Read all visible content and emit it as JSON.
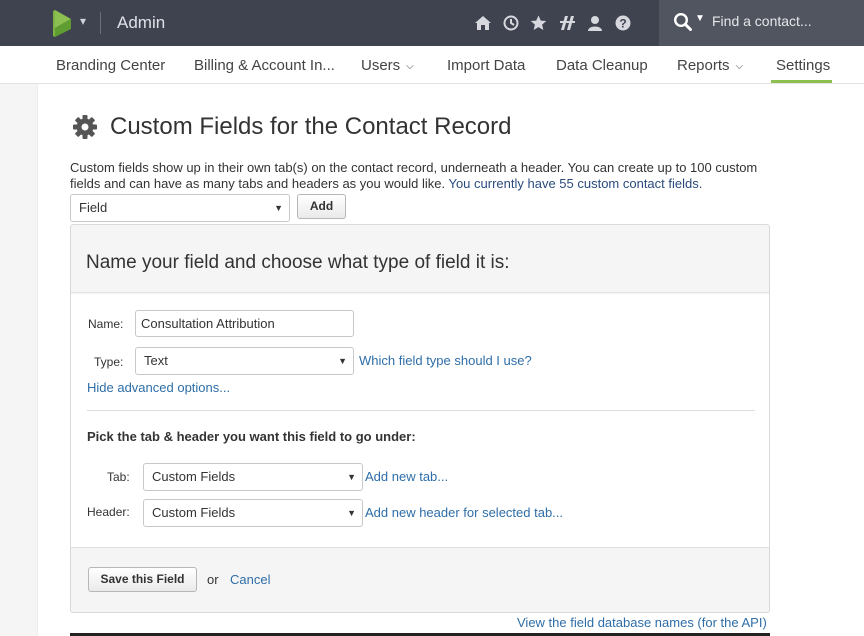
{
  "topbar": {
    "app_title": "Admin",
    "icons": [
      "home-icon",
      "history-icon",
      "star-icon",
      "dashboard-icon",
      "user-icon",
      "help-icon"
    ],
    "search_placeholder": "Find a contact..."
  },
  "nav": {
    "items": [
      {
        "label": "Branding Center",
        "has_dropdown": false
      },
      {
        "label": "Billing & Account In...",
        "has_dropdown": false
      },
      {
        "label": "Users",
        "has_dropdown": true
      },
      {
        "label": "Import Data",
        "has_dropdown": false
      },
      {
        "label": "Data Cleanup",
        "has_dropdown": false
      },
      {
        "label": "Reports",
        "has_dropdown": true
      },
      {
        "label": "Settings",
        "has_dropdown": false,
        "active": true
      }
    ],
    "active_color": "#8cc152"
  },
  "page": {
    "title": "Custom Fields for the Contact Record",
    "intro_text": "Custom fields show up in their own tab(s) on the contact record, underneath a header. You can create up to 100 custom fields and can have as many tabs and headers as you would like.",
    "intro_count": "You currently have 55 custom contact fields.",
    "add_select_value": "Field",
    "add_button": "Add"
  },
  "form": {
    "heading": "Name your field and choose what type of field it is:",
    "name_label": "Name:",
    "name_value": "Consultation Attribution",
    "type_label": "Type:",
    "type_value": "Text",
    "type_help_link": "Which field type should I use?",
    "advanced_link": "Hide advanced options...",
    "location_heading": "Pick the tab & header you want this field to go under:",
    "tab_label": "Tab:",
    "tab_value": "Custom Fields",
    "new_tab_link": "Add new tab...",
    "header_label": "Header:",
    "header_value": "Custom Fields",
    "new_header_link": "Add new header for selected tab...",
    "save_button": "Save this Field",
    "or_text": "or",
    "cancel_link": "Cancel"
  },
  "api_link": "View the field database names (for the API)",
  "colors": {
    "topbar": "#3f4350",
    "link": "#2e6ea8"
  }
}
